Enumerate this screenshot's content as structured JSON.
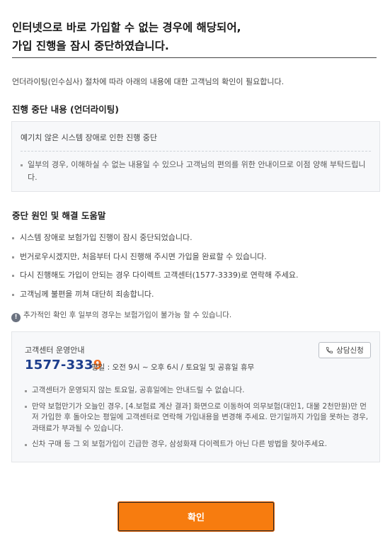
{
  "header": {
    "title_line1": "인터넷으로 바로 가입할 수 없는 경우에 해당되어,",
    "title_line2": "가입 진행을 잠시 중단하였습니다."
  },
  "intro_text": "언더라이팅(인수심사) 절차에 따라 아래의 내용에 대한 고객님의 확인이 필요합니다.",
  "suspension": {
    "title": "진행 중단 내용 (언더라이팅)",
    "reason": "예기치 않은 시스템 장애로 인한 진행 중단",
    "note": "일부의 경우, 이해하실 수 없는 내용일 수 있으나 고객님의 편의를 위한 안내이므로 이점 양해 부탁드립니다."
  },
  "help": {
    "title": "중단 원인 및 해결 도움말",
    "items": [
      "시스템 장애로 보험가입 진행이 잠시 중단되었습니다.",
      "번거로우시겠지만, 처음부터 다시 진행해 주시면 가입을 완료할 수 있습니다.",
      "다시 진행해도 가입이 안되는 경우 다이렉트 고객센터(1577-3339)로 연락해 주세요.",
      "고객님께 불편을 끼쳐 대단히 죄송합니다."
    ],
    "notice_icon": "exclamation-icon",
    "notice": "추가적인 확인 후 일부의 경우는 보험가입이 불가능 할 수 있습니다."
  },
  "service_center": {
    "label": "고객센터 운영안내",
    "phone_main": "1577-333",
    "phone_last": "9",
    "hours": "평일 : 오전 9시 ~ 오후 6시 / 토요일 및 공휴일 휴무",
    "consult_button": "상담신청",
    "consult_icon": "phone-icon",
    "notes": [
      "고객센터가 운영되지 않는 토요일, 공휴일에는 안내드릴 수 없습니다.",
      "만약 보험만기가 오늘인 경우, [4.보험료 계산 결과] 화면으로 이동하여 의무보험(대인1, 대물 2천만원)만 먼저 가입한 후 돌아오는 평일에 고객센터로 연락해 가입내용을 변경해 주세요. 만기일까지 가입을 못하는 경우, 과태료가 부과될 수 있습니다.",
      "신차 구매 등 그 외 보험가입이 긴급한 경우, 삼성화재 다이렉트가 아닌 다른 방법을 찾아주세요."
    ]
  },
  "confirm_button": "확인",
  "colors": {
    "primary_orange": "#f77c0f",
    "phone_blue": "#1c3d8c",
    "phone_accent": "#f26f21",
    "box_bg": "#f7f8fa"
  }
}
